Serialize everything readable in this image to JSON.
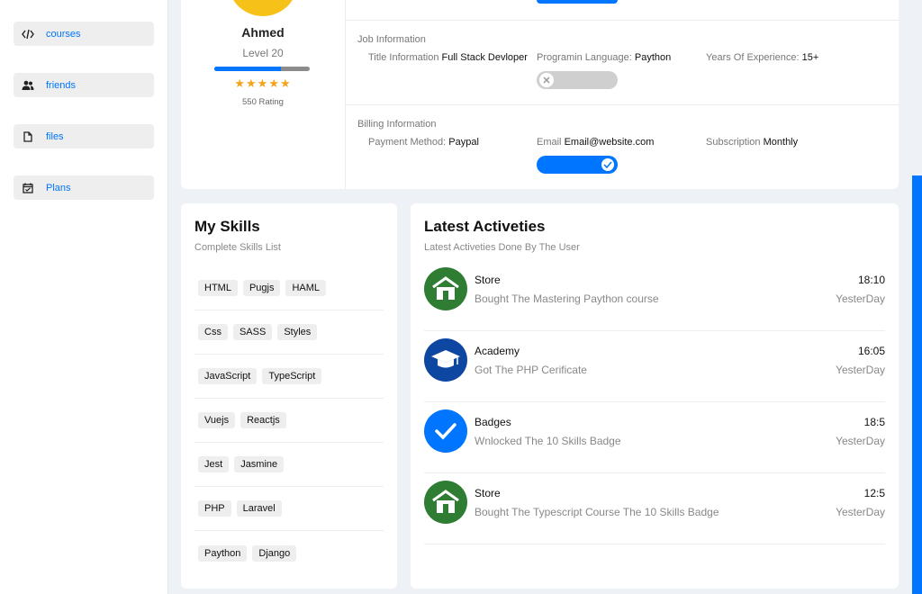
{
  "sidebar": {
    "items": [
      {
        "label": "courses",
        "icon": "code-icon"
      },
      {
        "label": "friends",
        "icon": "users-icon"
      },
      {
        "label": "files",
        "icon": "file-icon"
      },
      {
        "label": "Plans",
        "icon": "calendar-icon"
      }
    ]
  },
  "profile": {
    "name": "Ahmed",
    "level": "Level 20",
    "progress": 0.7,
    "stars": "★★★★★",
    "rating": "550 Rating"
  },
  "job": {
    "title": "Job Information",
    "title_label": "Title Information",
    "title_value": "Full Stack Devloper",
    "lang_label": "Programin Language:",
    "lang_value": "Paython",
    "exp_label": "Years Of Experience:",
    "exp_value": "15+"
  },
  "billing": {
    "title": "Billing Information",
    "payment_label": "Payment Method:",
    "payment_value": "Paypal",
    "email_label": "Email",
    "email_value": "Email@website.com",
    "sub_label": "Subscription",
    "sub_value": "Monthly"
  },
  "skills": {
    "title": "My Skills",
    "subtitle": "Complete Skills List",
    "rows": [
      [
        "HTML",
        "Pugjs",
        "HAML"
      ],
      [
        "Css",
        "SASS",
        "Styles"
      ],
      [
        "JavaScript",
        "TypeScript"
      ],
      [
        "Vuejs",
        "Reactjs"
      ],
      [
        "Jest",
        "Jasmine"
      ],
      [
        "PHP",
        "Laravel"
      ],
      [
        "Paython",
        "Django"
      ]
    ]
  },
  "activities": {
    "title": "Latest Activeties",
    "subtitle": "Latest Activeties Done By The User",
    "items": [
      {
        "title": "Store",
        "desc": "Bought The Mastering Paython course",
        "time": "18:10",
        "day": "YesterDay",
        "icon": "store-icon",
        "color": "#2e7d32"
      },
      {
        "title": "Academy",
        "desc": "Got The PHP Cerificate",
        "time": "16:05",
        "day": "YesterDay",
        "icon": "graduation-cap-icon",
        "color": "#0d47a1"
      },
      {
        "title": "Badges",
        "desc": "Wnlocked The 10 Skills Badge",
        "time": "18:5",
        "day": "YesterDay",
        "icon": "check-badge-icon",
        "color": "#0075ff"
      },
      {
        "title": "Store",
        "desc": "Bought The Typescript Course The 10 Skills Badge",
        "time": "12:5",
        "day": "YesterDay",
        "icon": "store-icon",
        "color": "#2e7d32"
      }
    ]
  },
  "colors": {
    "accent": "#0075ff",
    "star": "#f3a41c"
  }
}
